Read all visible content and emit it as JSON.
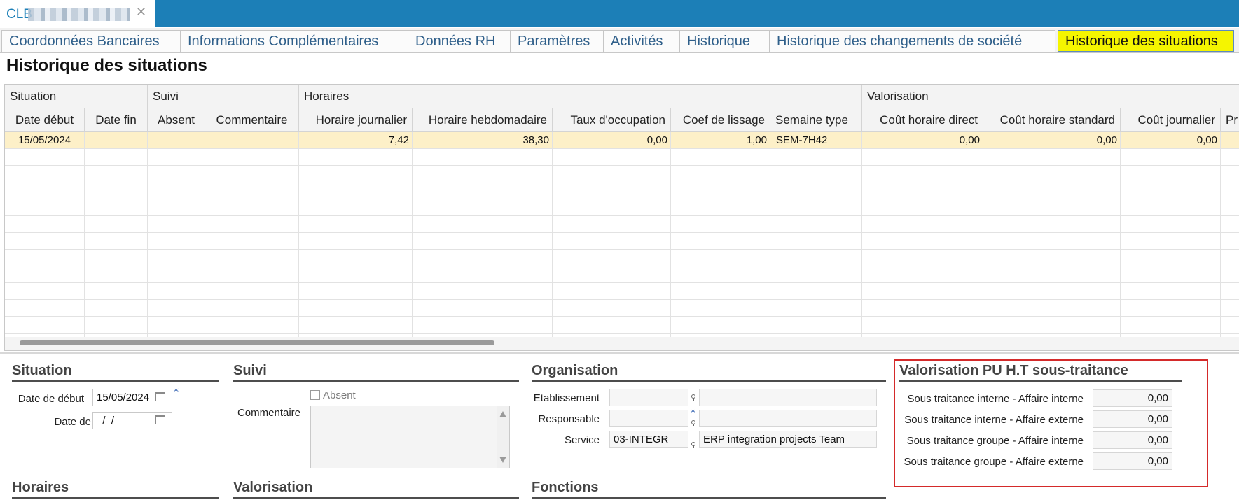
{
  "window": {
    "doc_title": "CLB"
  },
  "tabs": [
    {
      "label": "Coordonnées Bancaires"
    },
    {
      "label": "Informations Complémentaires"
    },
    {
      "label": "Données RH"
    },
    {
      "label": "Paramètres"
    },
    {
      "label": "Activités"
    },
    {
      "label": "Historique"
    },
    {
      "label": "Historique des changements de société"
    },
    {
      "label": "Historique des situations"
    }
  ],
  "page_title": "Historique des situations",
  "grid": {
    "groups": [
      "Situation",
      "Suivi",
      "Horaires",
      "Valorisation"
    ],
    "columns": [
      "Date début",
      "Date fin",
      "Absent",
      "Commentaire",
      "Horaire journalier",
      "Horaire hebdomadaire",
      "Taux d'occupation",
      "Coef de lissage",
      "Semaine type",
      "Coût horaire direct",
      "Coût horaire standard",
      "Coût journalier",
      "Pr"
    ],
    "rows": [
      [
        "15/05/2024",
        "",
        "",
        "",
        "7,42",
        "38,30",
        "0,00",
        "1,00",
        "SEM-7H42",
        "0,00",
        "0,00",
        "0,00",
        ""
      ]
    ]
  },
  "form": {
    "situation": {
      "title": "Situation",
      "date_debut_label": "Date de début",
      "date_debut_value": "15/05/2024",
      "date_fin_label": "Date de fin",
      "date_fin_value": "  /  /"
    },
    "suivi": {
      "title": "Suivi",
      "absent_label": "Absent",
      "commentaire_label": "Commentaire"
    },
    "organisation": {
      "title": "Organisation",
      "etablissement_label": "Etablissement",
      "responsable_label": "Responsable",
      "service_label": "Service",
      "service_code": "03-INTEGR",
      "service_name": "ERP integration projects Team"
    },
    "valorisation_pu": {
      "title": "Valorisation PU H.T sous-traitance",
      "fields": [
        {
          "label": "Sous traitance interne - Affaire interne",
          "value": "0,00"
        },
        {
          "label": "Sous traitance interne - Affaire externe",
          "value": "0,00"
        },
        {
          "label": "Sous traitance groupe - Affaire interne",
          "value": "0,00"
        },
        {
          "label": "Sous traitance groupe - Affaire externe",
          "value": "0,00"
        }
      ]
    },
    "lower_sections": {
      "horaires": "Horaires",
      "valorisation": "Valorisation",
      "fonctions": "Fonctions"
    }
  },
  "colors": {
    "accent": "#1c7fb7",
    "active_tab": "#f5f500",
    "selected_row": "#fdf0c8",
    "highlight_border": "#d42a2a"
  }
}
